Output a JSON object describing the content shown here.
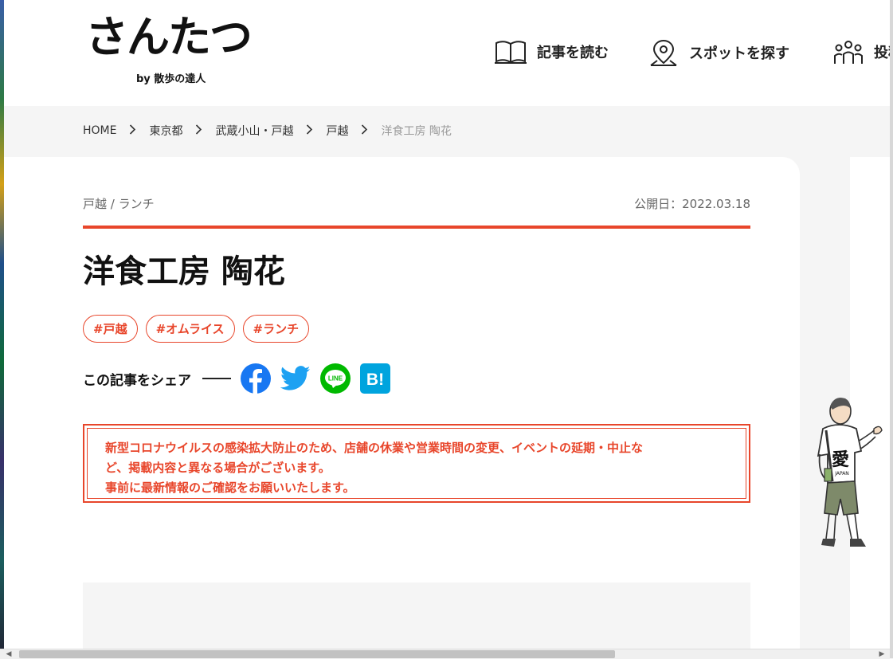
{
  "site": {
    "logo_text": "さんたつ",
    "logo_sub": "by 散歩の達人"
  },
  "nav": {
    "items": [
      {
        "label": "記事を読む",
        "icon": "book-icon"
      },
      {
        "label": "スポットを探す",
        "icon": "map-pin-icon"
      },
      {
        "label": "投稿",
        "icon": "people-icon"
      }
    ]
  },
  "breadcrumb": {
    "items": [
      "HOME",
      "東京都",
      "武蔵小山・戸越",
      "戸越"
    ],
    "current": "洋食工房 陶花"
  },
  "article": {
    "category": "戸越 / ランチ",
    "published": "公開日：2022.03.18",
    "title": "洋食工房 陶花",
    "tags": [
      "#戸越",
      "#オムライス",
      "#ランチ"
    ]
  },
  "share": {
    "label": "この記事をシェア",
    "services": [
      {
        "name": "facebook",
        "icon": "facebook-icon",
        "color": "#1877f2"
      },
      {
        "name": "twitter",
        "icon": "twitter-icon",
        "color": "#1da1f2"
      },
      {
        "name": "line",
        "icon": "line-icon",
        "color": "#00b900",
        "text": "LINE"
      },
      {
        "name": "hatena",
        "icon": "hatena-bookmark-icon",
        "color": "#00a4de",
        "text": "B!"
      }
    ]
  },
  "notice": {
    "lines": [
      "新型コロナウイルスの感染拡大防止のため、店舗の休業や営業時間の変更、イベントの延期・中止な",
      "ど、掲載内容と異なる場合がございます。",
      "事前に最新情報のご確認をお願いいたします。"
    ]
  },
  "mascot": {
    "shirt_text": "愛",
    "shirt_sub": "JAPAN"
  },
  "colors": {
    "accent": "#e8462b",
    "background": "#f5f5f5"
  }
}
